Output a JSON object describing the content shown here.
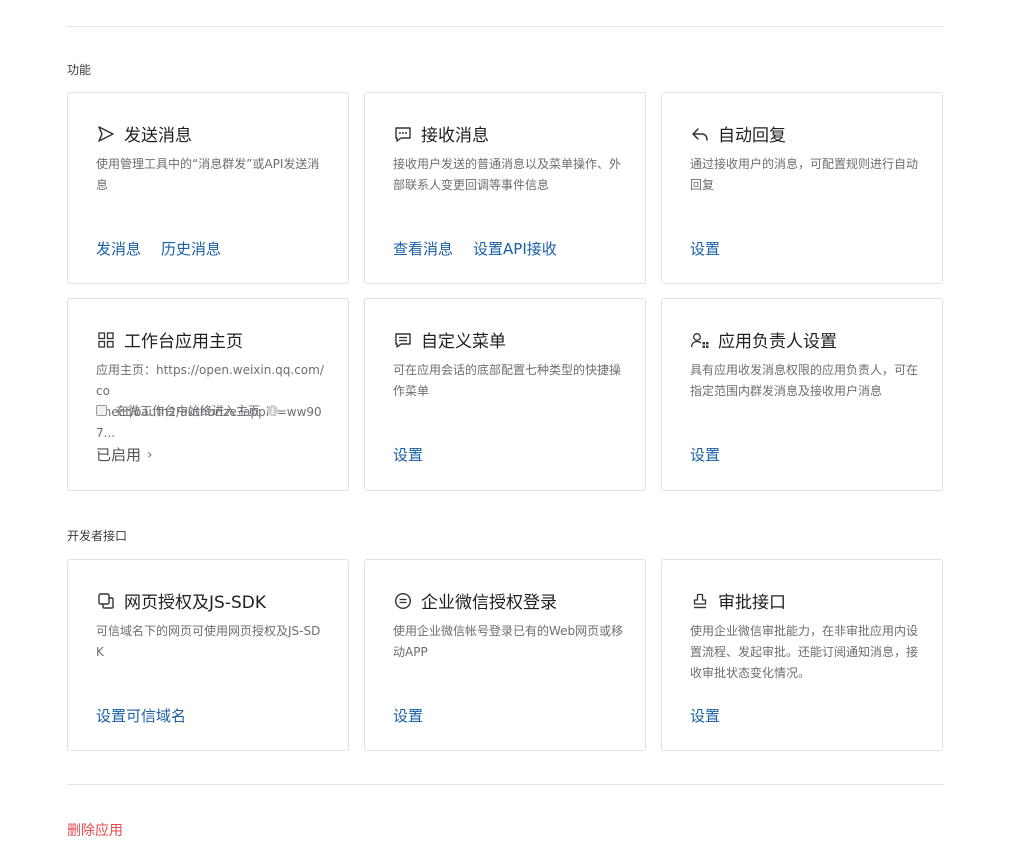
{
  "sections": {
    "features_title": "功能",
    "developer_title": "开发者接口"
  },
  "cards": {
    "send": {
      "title": "发送消息",
      "desc": "使用管理工具中的“消息群发”或API发送消息",
      "link1": "发消息",
      "link2": "历史消息"
    },
    "receive": {
      "title": "接收消息",
      "desc": "接收用户发送的普通消息以及菜单操作、外部联系人变更回调等事件信息",
      "link1": "查看消息",
      "link2": "设置API接收"
    },
    "autoreply": {
      "title": "自动回复",
      "desc": "通过接收用户的消息，可配置规则进行自动回复",
      "link1": "设置"
    },
    "homepage": {
      "title": "工作台应用主页",
      "desc_line1": "应用主页：https://open.weixin.qq.com/co",
      "desc_line2": "nnect/oauth2/authorize?appid=ww907...",
      "checkbox_label": "在微工作台中始终进入主页",
      "status": "已启用"
    },
    "menu": {
      "title": "自定义菜单",
      "desc": "可在应用会话的底部配置七种类型的快捷操作菜单",
      "link1": "设置"
    },
    "owner": {
      "title": "应用负责人设置",
      "desc": "具有应用收发消息权限的应用负责人，可在指定范围内群发消息及接收用户消息",
      "link1": "设置"
    },
    "jssdk": {
      "title": "网页授权及JS-SDK",
      "desc": "可信域名下的网页可使用网页授权及JS-SDK",
      "link1": "设置可信域名"
    },
    "login": {
      "title": "企业微信授权登录",
      "desc": "使用企业微信帐号登录已有的Web网页或移动APP",
      "link1": "设置"
    },
    "approval": {
      "title": "审批接口",
      "desc": "使用企业微信审批能力，在非审批应用内设置流程、发起审批。还能订阅通知消息，接收审批状态变化情况。",
      "link1": "设置"
    }
  },
  "footer": {
    "delete_label": "删除应用"
  },
  "colors": {
    "link": "#1a5fa6",
    "danger": "#e5494d",
    "border": "#dfe1e5"
  },
  "icons": [
    "send-icon",
    "chat-icon",
    "reply-icon",
    "grid-icon",
    "menu-icon",
    "user-settings-icon",
    "window-icon",
    "wechat-login-icon",
    "stamp-icon",
    "info-icon",
    "chevron-right-icon"
  ]
}
